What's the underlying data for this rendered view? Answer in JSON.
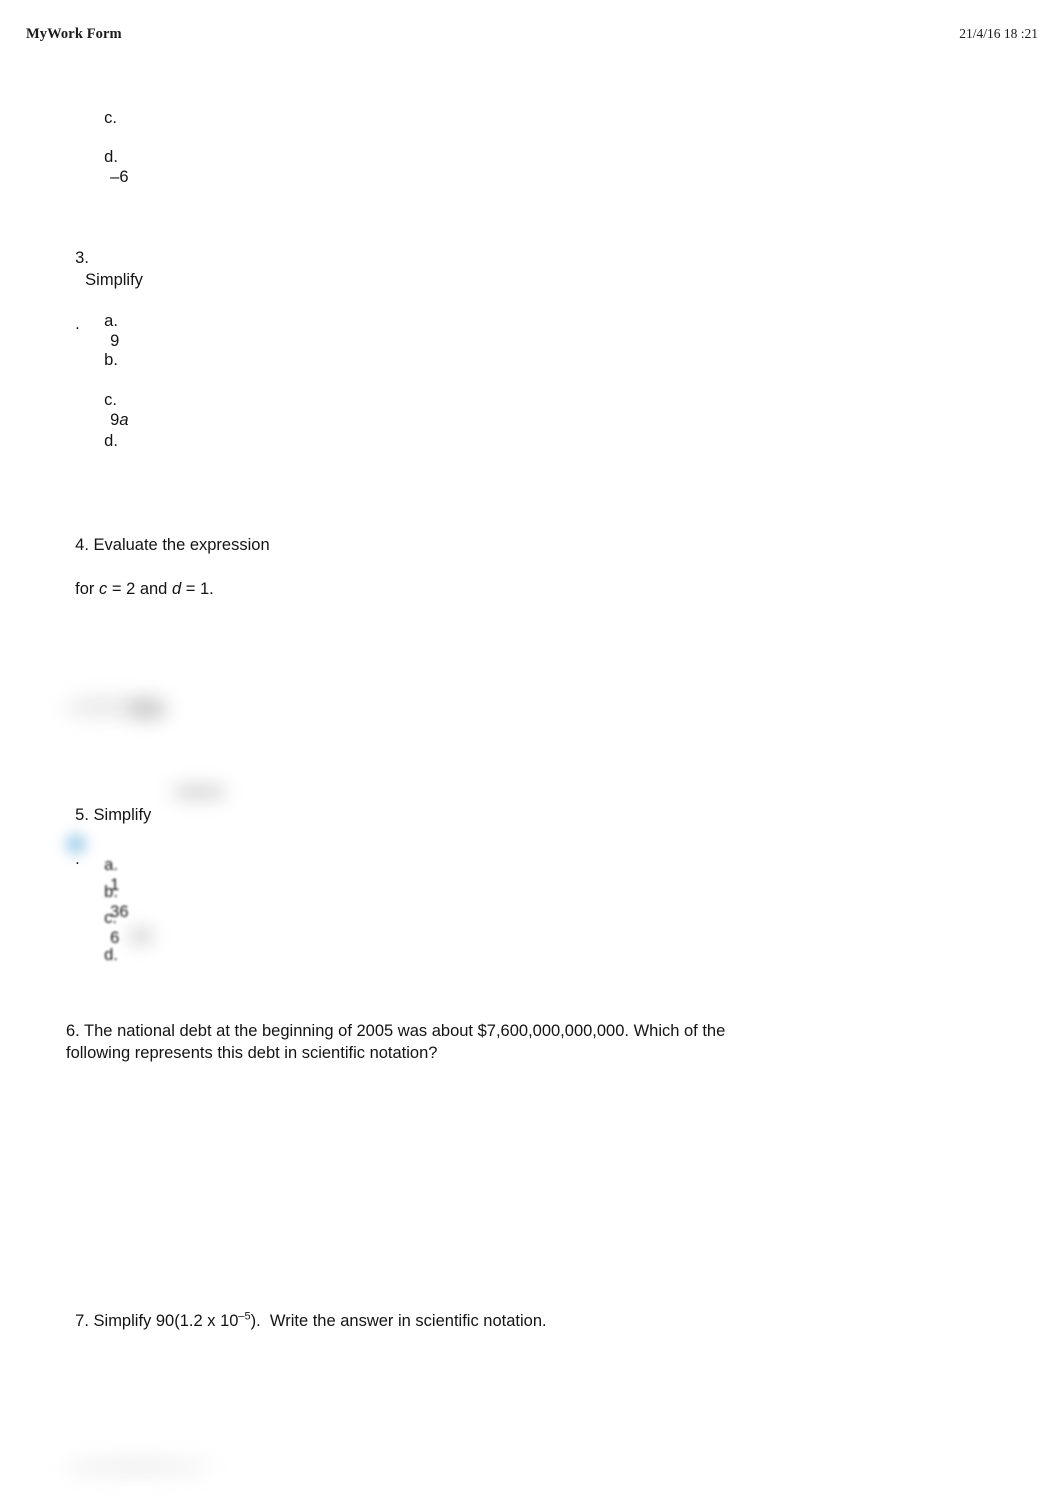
{
  "document": {
    "header": {
      "title": "MyWork Form",
      "timestamp": "21/4/16 18  :21"
    },
    "questions": [
      {
        "id": "q2-tail",
        "options": [
          {
            "label": "c.",
            "value": ""
          },
          {
            "label": "d.",
            "value": "–6"
          }
        ]
      },
      {
        "id": "q3",
        "number": "3.",
        "prompt_before": "Simplify",
        "prompt_after": ".",
        "options": [
          {
            "label": "a.",
            "value": "9"
          },
          {
            "label": "b.",
            "value": ""
          },
          {
            "label": "c.",
            "value": "9a",
            "italic_tail": "a",
            "prefix": "9"
          },
          {
            "label": "d.",
            "value": ""
          }
        ]
      },
      {
        "id": "q4",
        "number": "4.",
        "text_part1": "4. Evaluate the expression",
        "text_part2": "for ",
        "var_c": "c",
        "eq_c": " = 2 and ",
        "var_d": "d",
        "eq_d": " = 1."
      },
      {
        "id": "q5",
        "number": "5.",
        "prompt_before": "5. Simplify",
        "prompt_after": ".",
        "options": [
          {
            "label": "a.",
            "value": "1"
          },
          {
            "label": "b.",
            "value": "36"
          },
          {
            "label": "c.",
            "value": "6"
          },
          {
            "label": "d.",
            "value": ""
          }
        ],
        "marker_color": "#6fb3e0"
      },
      {
        "id": "q6",
        "number": "6.",
        "line1": "6. The national debt at the beginning of 2005 was about $7,600,000,000,000.  Which of the",
        "line2": "following represents this debt in scientific notation?"
      },
      {
        "id": "q7",
        "number": "7.",
        "text_before": "7. Simplify 90(1.2 x 10",
        "exponent": "–5",
        "text_after": ").  Write the answer in scientific notation."
      }
    ]
  }
}
